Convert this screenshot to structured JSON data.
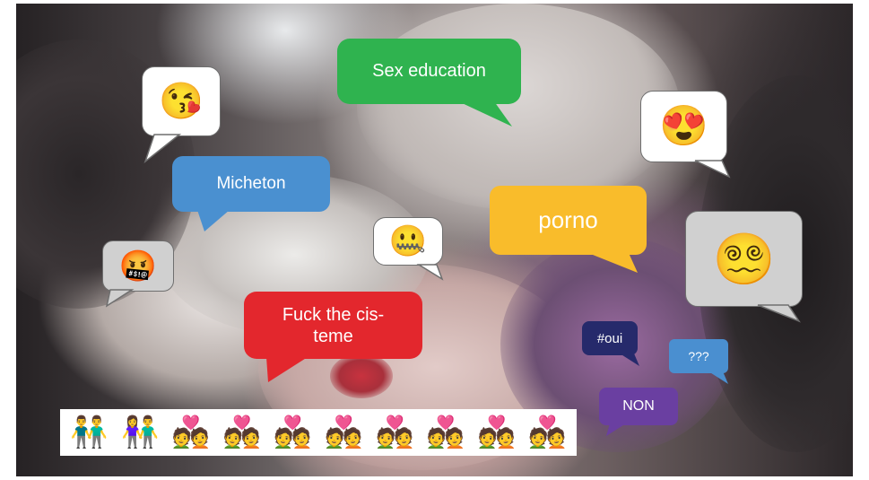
{
  "bubbles": {
    "sex_education": "Sex education",
    "micheton": "Micheton",
    "porno": "porno",
    "fuck_cisteme_line1": "Fuck the cis-",
    "fuck_cisteme_line2": "teme",
    "oui": "#oui",
    "question": "???",
    "non": "NON"
  },
  "emojis": {
    "kissing_face": "😘",
    "heart_eyes": "😍",
    "cursing_face": "🤬",
    "zipper_mouth": "🤐",
    "dizzy_face": "😵‍💫"
  },
  "couples_strip": [
    "👬",
    "👫",
    "💑",
    "💑",
    "💑",
    "💑",
    "💑",
    "💑",
    "💑",
    "💑"
  ],
  "colors": {
    "green": "#2fb34f",
    "blue": "#4a90d0",
    "yellow": "#f9bc2b",
    "red": "#e3272d",
    "navy": "#262a6b",
    "purple": "#6a3fa1",
    "light_blue": "#4a8fd0",
    "gray": "#d0d0d0"
  }
}
